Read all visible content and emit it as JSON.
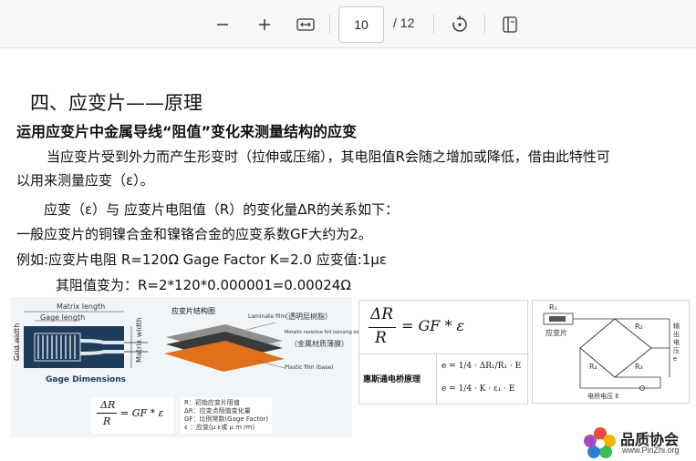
{
  "toolbar": {
    "zoom_out_icon": "minus-icon",
    "zoom_in_icon": "plus-icon",
    "fit_icon": "fit-width-icon",
    "page_current": "10",
    "page_total": "/ 12",
    "rotate_icon": "rotate-icon",
    "view_icon": "page-view-icon"
  },
  "doc": {
    "heading": "四、应变片——原理",
    "subheading": "运用应变片中金属导线“阻值”变化来测量结构的应变",
    "para1a": "当应变片受到外力而产生形变时（拉伸或压缩），其电阻值R会随之增加或降低，借由此特性可",
    "para1b": "以用来测量应变（ε）。",
    "para2": "应变（ε）与 应变片电阻值（R）的变化量ΔR的关系如下：",
    "para3": "一般应变片的铜镍合金和镍铬合金的应变系数GF大约为2。",
    "para4": "例如:应变片电阻 R=120Ω  Gage Factor K=2.0  应变值:1με",
    "para5": "其阻值变为：R=2*120*0.000001=0.00024Ω"
  },
  "fig1": {
    "matrix_length": "Matrix length",
    "gage_length": "Gage length",
    "grid_width": "Grid width",
    "matrix_width": "Matrix width",
    "dims_label": "Gage Dimensions",
    "struct_title": "应变片结构图",
    "laminate": "Laminate film",
    "layer1": "（透明层树脂）",
    "foil": "Metallic resistive foil (sensing element)",
    "layer2": "（金属材质薄膜）",
    "plastic": "Plastic film (base)",
    "formula_lhs_top": "ΔR",
    "formula_lhs_bottom": "R",
    "formula_rhs": "= GF * ε",
    "legend": [
      "R：初始应变片阻值",
      "ΔR：应变点阻值变化量",
      "GF：比例常数(Gage Factor)",
      "ε ：应变(μ ε或 μ m /m)"
    ]
  },
  "fig2": {
    "formula_lhs_top": "ΔR",
    "formula_lhs_bottom": "R",
    "formula_rhs": "= GF * ε",
    "bridge_label": "惠斯通电桥原理",
    "eq1_prefix": "e =",
    "eq1_frac": "1/4",
    "eq1_rest": "· ΔR₁/R₁ · E",
    "eq2_prefix": "e =",
    "eq2_frac": "1/4",
    "eq2_rest": "· K · ε₁ · E"
  },
  "fig3": {
    "r1": "R₁",
    "r2": "R₂",
    "r3": "R₃",
    "r4": "R₄",
    "gauge_label": "应变片",
    "out_label": "输出电压 e",
    "bridge_voltage": "电桥电压 E"
  },
  "logo": {
    "name": "品质协会",
    "url": "www.PinZhi.org"
  }
}
